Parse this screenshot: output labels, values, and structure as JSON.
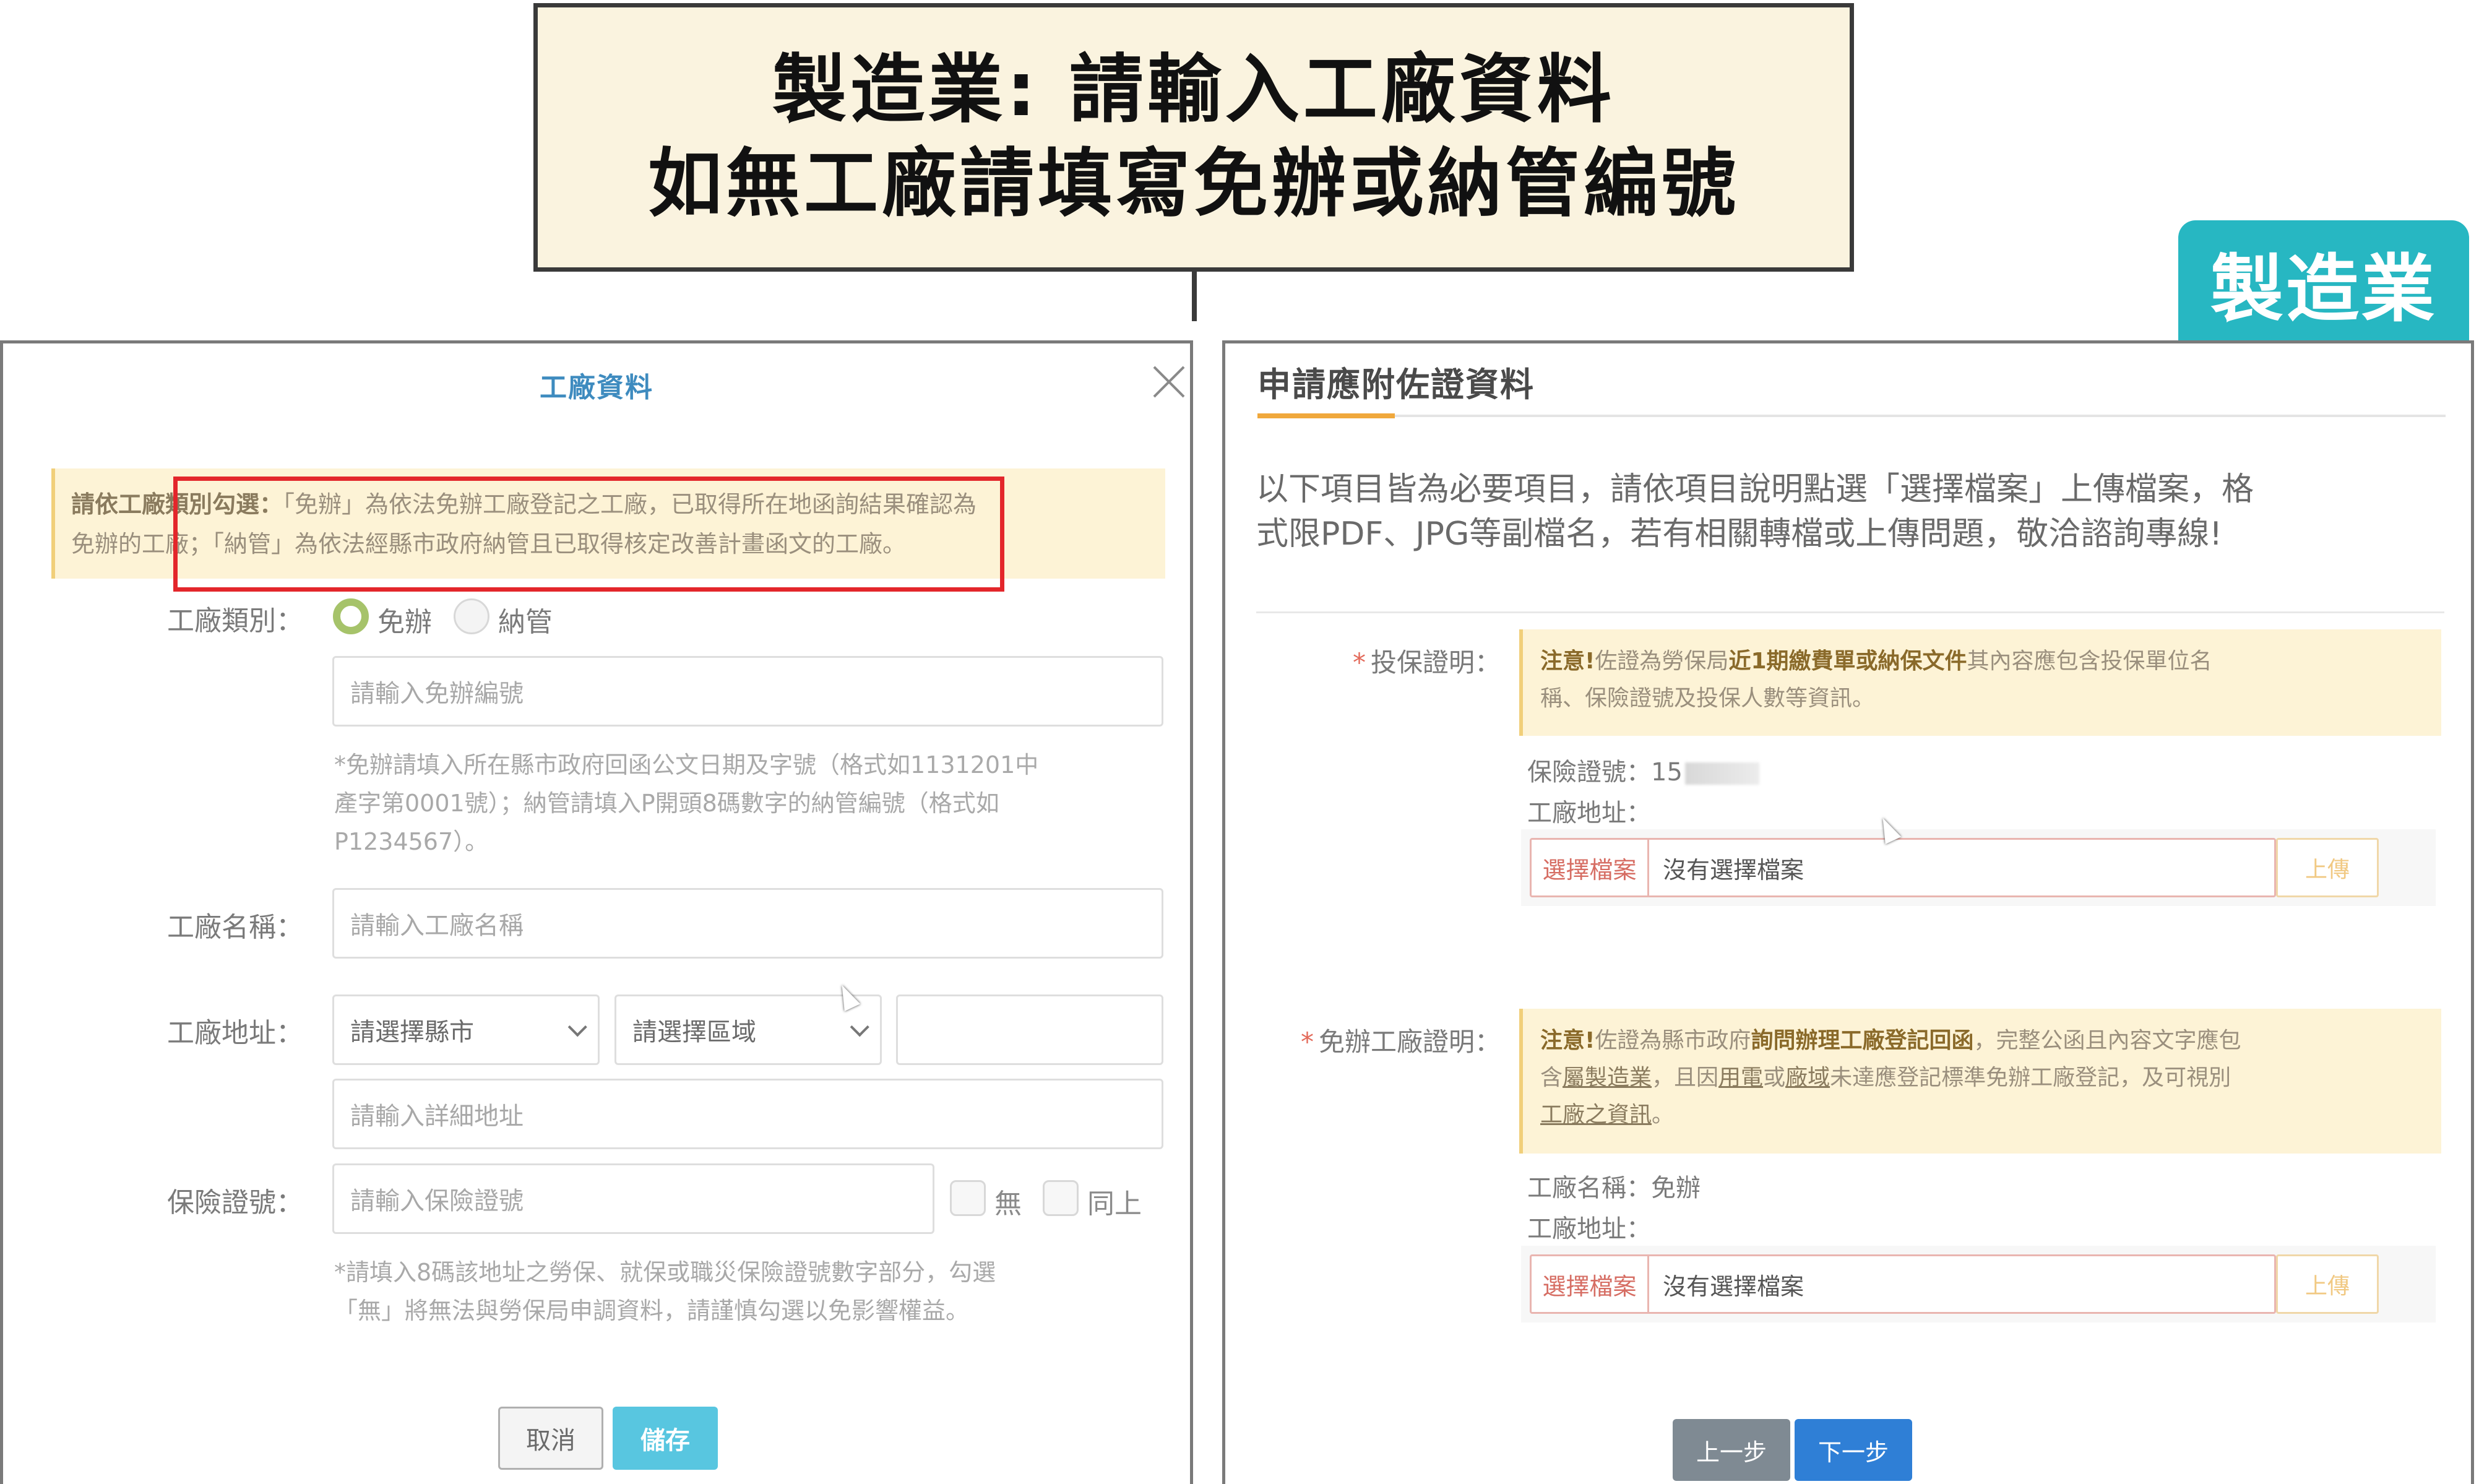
{
  "callout": {
    "line1": "製造業: 請輸入工廠資料",
    "line2": "如無工廠請填寫免辦或納管編號"
  },
  "industry_tag": "製造業",
  "left_modal": {
    "title": "工廠資料",
    "notice_bold": "請依工廠類別勾選：",
    "notice_line1_rest": "「免辦」為依法免辦工廠登記之工廠，已取得所在地函詢結果確認為",
    "notice_line2": "免辦的工廠；「納管」為依法經縣市政府納管且已取得核定改善計畫函文的工廠。",
    "factory_type_label": "工廠類別：",
    "radio_exempt": "免辦",
    "radio_managed": "納管",
    "exempt_no_placeholder": "請輸入免辦編號",
    "hint_exempt": [
      "*免辦請填入所在縣市政府回函公文日期及字號（格式如1131201中",
      "產字第0001號）；納管請填入P開頭8碼數字的納管編號（格式如",
      "P1234567）。"
    ],
    "factory_name_label": "工廠名稱：",
    "factory_name_placeholder": "請輸入工廠名稱",
    "factory_address_label": "工廠地址：",
    "county_select": "請選擇縣市",
    "district_select": "請選擇區域",
    "address_placeholder": "請輸入詳細地址",
    "insurance_label": "保險證號：",
    "insurance_placeholder": "請輸入保險證號",
    "check_none": "無",
    "check_same": "同上",
    "hint_insurance": [
      "*請填入8碼該地址之勞保、就保或職災保險證號數字部分，勾選",
      "「無」將無法與勞保局申調資料，請謹慎勾選以免影響權益。"
    ],
    "cancel_button": "取消",
    "save_button": "儲存"
  },
  "right_panel": {
    "title": "申請應附佐證資料",
    "intro": [
      "以下項目皆為必要項目，請依項目說明點選「選擇檔案」上傳檔案，格",
      "式限PDF、JPG等副檔名，若有相關轉檔或上傳問題，敬洽諮詢專線!"
    ],
    "insurance_proof_label": "投保證明：",
    "insurance_warn": {
      "bold1": "注意!",
      "text1": "佐證為勞保局",
      "bold2": "近1期繳費單或納保文件",
      "text2": "其內容應包含投保單位名",
      "line2": "稱、保險證號及投保人數等資訊。"
    },
    "insurance_no_label": "保險證號：15",
    "factory_address_label": "工廠地址：",
    "choose_file": "選擇檔案",
    "no_file": "沒有選擇檔案",
    "upload": "上傳",
    "exempt_proof_label": "免辦工廠證明：",
    "exempt_warn": {
      "bold1": "注意!",
      "text1": "佐證為縣市政府",
      "bold2": "詢問辦理工廠登記回函",
      "text2": "，完整公函且內容文字應包",
      "line2_a": "含",
      "line2_u1": "屬製造業",
      "line2_b": "，且因",
      "line2_u2": "用電",
      "line2_c": "或",
      "line2_u3": "廠域",
      "line2_d": "未達應登記標準免辦工廠登記，及可視別",
      "line3_u": "工廠之資訊",
      "line3_end": "。"
    },
    "factory_name_line": "工廠名稱：免辦",
    "factory_address_line": "工廠地址：",
    "prev_button": "上一步",
    "next_button": "下一步"
  }
}
